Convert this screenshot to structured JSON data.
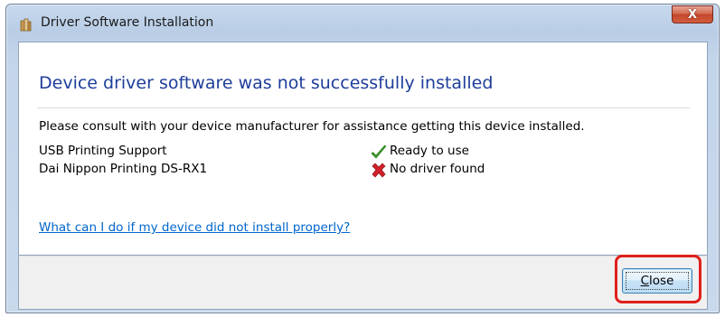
{
  "window": {
    "title": "Driver Software Installation",
    "close_glyph": "X",
    "icon": "driver-package-icon"
  },
  "content": {
    "heading": "Device driver software was not successfully installed",
    "message": "Please consult with your device manufacturer for assistance getting this device installed.",
    "devices": [
      {
        "name": "USB Printing Support",
        "status": "Ready to use",
        "status_icon": "green-check-icon",
        "status_color": "#3a9a2a"
      },
      {
        "name": "Dai Nippon Printing DS-RX1",
        "status": "No driver found",
        "status_icon": "red-x-icon",
        "status_color": "#d1222a"
      }
    ],
    "help_link": "What can I do if my device did not install properly?"
  },
  "footer": {
    "close_button": {
      "mnemonic": "C",
      "rest": "lose"
    },
    "highlight_color": "#e0201c"
  },
  "colors": {
    "heading": "#1e3e9a",
    "link": "#0066cc",
    "title_close": "#c4472b"
  }
}
